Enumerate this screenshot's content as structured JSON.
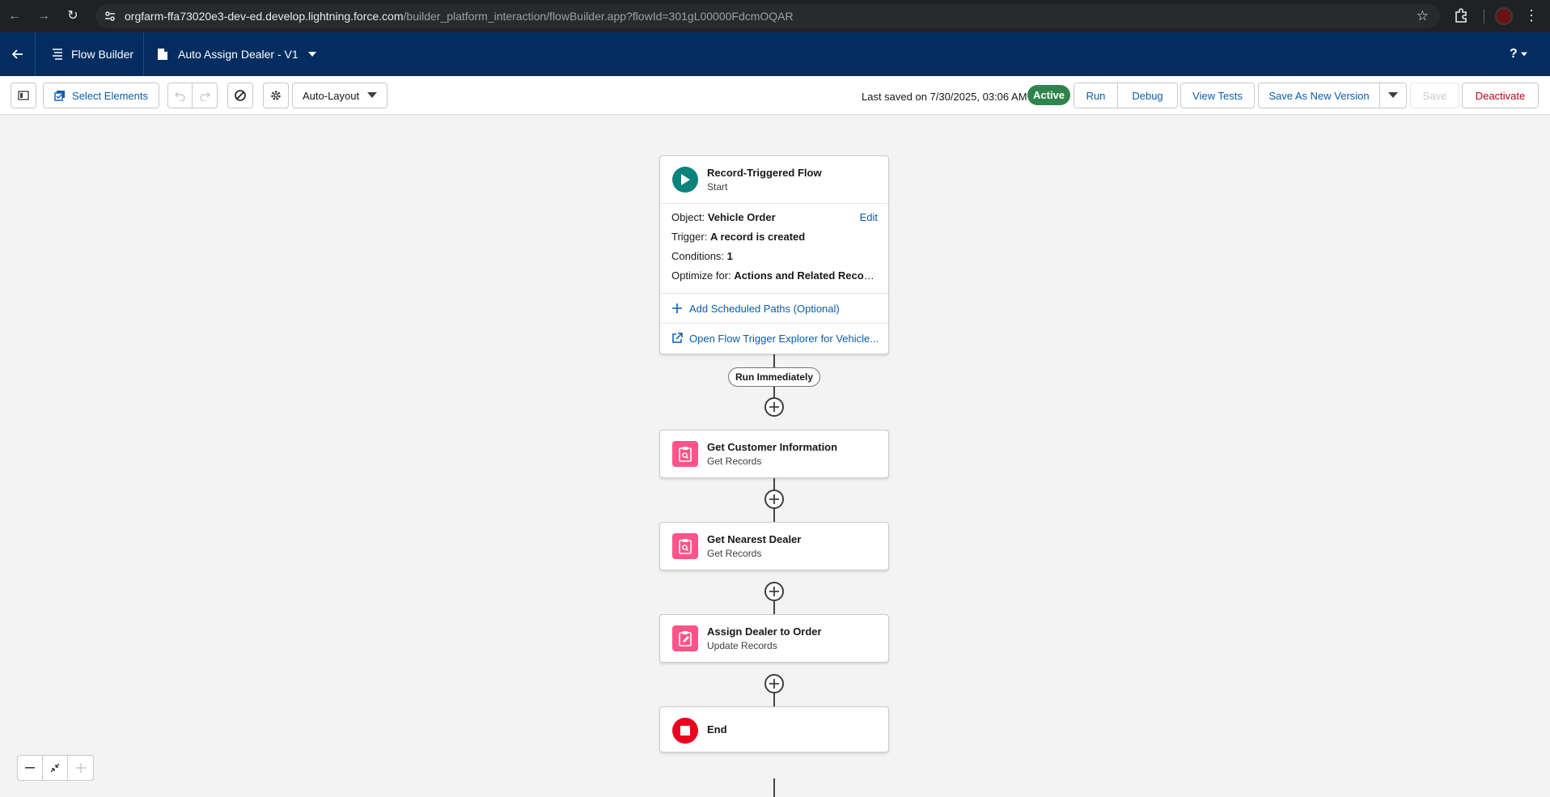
{
  "browser": {
    "url_host": "orgfarm-ffa73020e3-dev-ed.develop.lightning.force.com",
    "url_path": "/builder_platform_interaction/flowBuilder.app?flowId=301gL00000FdcmOQAR"
  },
  "header": {
    "app_name": "Flow Builder",
    "flow_name": "Auto Assign Dealer - V1",
    "help_label": "?"
  },
  "toolbar": {
    "select_elements": "Select Elements",
    "layout_mode": "Auto-Layout",
    "last_saved": "Last saved on 7/30/2025, 03:06 AM",
    "status": "Active",
    "run": "Run",
    "debug": "Debug",
    "view_tests": "View Tests",
    "save_as_new_version": "Save As New Version",
    "save": "Save",
    "deactivate": "Deactivate"
  },
  "start_node": {
    "title": "Record-Triggered Flow",
    "subtitle": "Start",
    "edit": "Edit",
    "object_label": "Object:",
    "object_value": "Vehicle Order",
    "trigger_label": "Trigger:",
    "trigger_value": "A record is created",
    "conditions_label": "Conditions:",
    "conditions_value": "1",
    "optimize_label": "Optimize for:",
    "optimize_value": "Actions and Related Records",
    "add_scheduled_paths": "Add Scheduled Paths (Optional)",
    "open_trigger_explorer": "Open Flow Trigger Explorer for Vehicle..."
  },
  "run_immediately": "Run Immediately",
  "nodes": [
    {
      "title": "Get Customer Information",
      "subtitle": "Get Records",
      "icon": "get-records-icon"
    },
    {
      "title": "Get Nearest Dealer",
      "subtitle": "Get Records",
      "icon": "get-records-icon"
    },
    {
      "title": "Assign Dealer to Order",
      "subtitle": "Update Records",
      "icon": "update-records-icon"
    }
  ],
  "end_node": {
    "title": "End"
  },
  "colors": {
    "header_bg": "#032d60",
    "brand_blue": "#0b5cab",
    "active_green": "#2e844a",
    "start_icon_teal": "#0b827c",
    "records_pink": "#ff538a",
    "end_red": "#ea001e",
    "deactivate_red": "#ba0517"
  }
}
